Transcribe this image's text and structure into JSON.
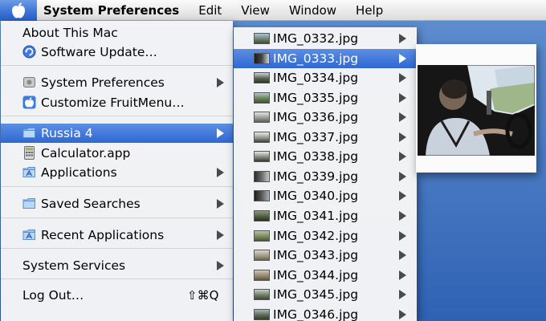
{
  "menubar": {
    "apple_icon": "apple-icon",
    "items": [
      "System Preferences",
      "Edit",
      "View",
      "Window",
      "Help"
    ]
  },
  "main_menu": {
    "items": [
      {
        "label": "About This Mac"
      },
      {
        "label": "Software Update…",
        "icon": "software-update-icon"
      },
      {
        "label": "System Preferences",
        "icon": "system-preferences-icon",
        "submenu": true
      },
      {
        "label": "Customize FruitMenu…",
        "icon": "apple-icon"
      },
      {
        "label": "Russia 4",
        "icon": "folder-icon",
        "submenu": true,
        "selected": true
      },
      {
        "label": "Calculator.app",
        "icon": "calculator-icon"
      },
      {
        "label": "Applications",
        "icon": "applications-folder-icon",
        "submenu": true
      },
      {
        "label": "Saved Searches",
        "icon": "folder-icon",
        "submenu": true
      },
      {
        "label": "Recent Applications",
        "icon": "recent-apps-icon",
        "submenu": true
      },
      {
        "label": "System Services",
        "submenu": true
      },
      {
        "label": "Log Out…",
        "shortcut": "⇧⌘Q"
      }
    ]
  },
  "sub_menu": {
    "items": [
      {
        "label": "IMG_0332.jpg"
      },
      {
        "label": "IMG_0333.jpg",
        "selected": true
      },
      {
        "label": "IMG_0334.jpg"
      },
      {
        "label": "IMG_0335.jpg"
      },
      {
        "label": "IMG_0336.jpg"
      },
      {
        "label": "IMG_0337.jpg"
      },
      {
        "label": "IMG_0338.jpg"
      },
      {
        "label": "IMG_0339.jpg"
      },
      {
        "label": "IMG_0340.jpg"
      },
      {
        "label": "IMG_0341.jpg"
      },
      {
        "label": "IMG_0342.jpg"
      },
      {
        "label": "IMG_0343.jpg"
      },
      {
        "label": "IMG_0344.jpg"
      },
      {
        "label": "IMG_0345.jpg"
      },
      {
        "label": "IMG_0346.jpg"
      }
    ]
  },
  "colors": {
    "selection": "#3a72d6",
    "desktop": "#4f7fc6"
  }
}
